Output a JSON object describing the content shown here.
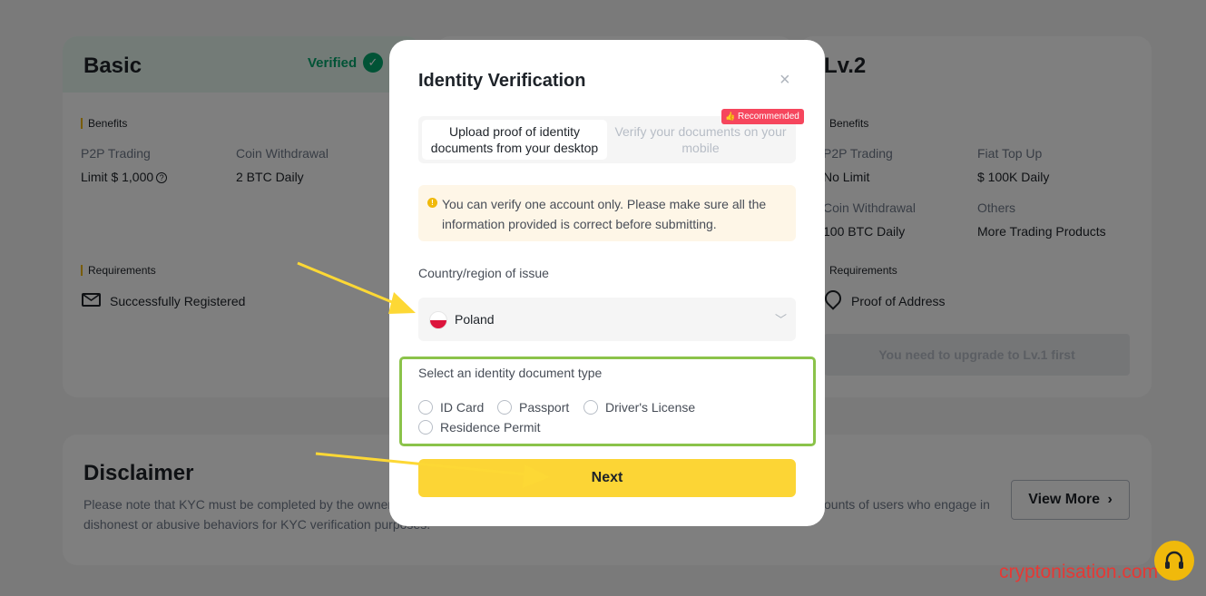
{
  "basic_card": {
    "title": "Basic",
    "verified_label": "Verified",
    "benefits_label": "Benefits",
    "p2p_label": "P2P Trading",
    "p2p_value": "Limit $ 1,000",
    "withdraw_label": "Coin Withdrawal",
    "withdraw_value": "2 BTC Daily",
    "requirements_label": "Requirements",
    "requirement": "Successfully Registered"
  },
  "lv2_card": {
    "title": "Lv.2",
    "benefits_label": "Benefits",
    "p2p_label": "P2P Trading",
    "p2p_value": "No Limit",
    "fiat_label": "Fiat Top Up",
    "fiat_value": "$ 100K Daily",
    "withdraw_label": "Coin Withdrawal",
    "withdraw_value": "100 BTC Daily",
    "others_label": "Others",
    "others_value": "More Trading Products",
    "requirements_label": "Requirements",
    "requirement": "Proof of Address",
    "upgrade_button": "You need to upgrade to Lv.1 first"
  },
  "disclaimer": {
    "title": "Disclaimer",
    "text_left": "Please note that KYC must be completed by the owner",
    "text_left_2": "dishonest or abusive behaviors for KYC verification purposes.",
    "text_right": "ounts of users who engage in",
    "view_more": "View More"
  },
  "modal": {
    "title": "Identity Verification",
    "close": "×",
    "tab_desktop": "Upload proof of identity documents from your desktop",
    "tab_mobile": "Verify your documents on your mobile",
    "recommended_badge": "Recommended",
    "warning": "You can verify one account only. Please make sure all the information provided is correct before submitting.",
    "country_label": "Country/region of issue",
    "country_value": "Poland",
    "doc_type_label": "Select an identity document type",
    "doc_options": [
      "ID Card",
      "Passport",
      "Driver's License",
      "Residence Permit"
    ],
    "next_button": "Next"
  },
  "watermark": "cryptonisation.com",
  "colors": {
    "accent": "#fcd535",
    "verified_green": "#03a66d",
    "highlight_frame": "#8bc34a",
    "annotation_arrow": "#fdd835"
  }
}
